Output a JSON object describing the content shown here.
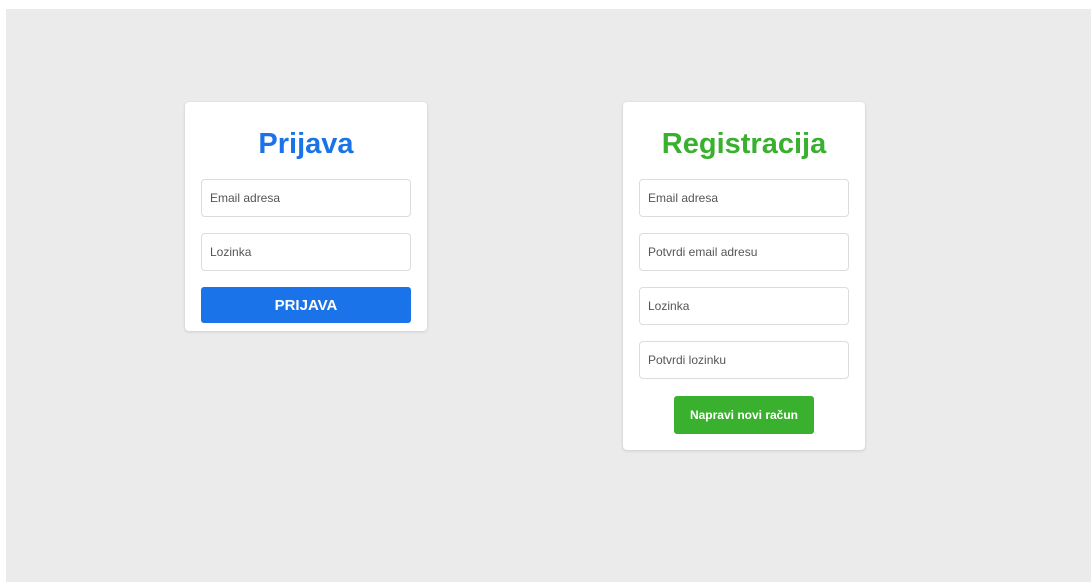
{
  "login": {
    "title": "Prijava",
    "email_placeholder": "Email adresa",
    "password_placeholder": "Lozinka",
    "submit_label": "PRIJAVA"
  },
  "register": {
    "title": "Registracija",
    "email_placeholder": "Email adresa",
    "confirm_email_placeholder": "Potvrdi email adresu",
    "password_placeholder": "Lozinka",
    "confirm_password_placeholder": "Potvrdi lozinku",
    "submit_label": "Napravi novi račun"
  },
  "colors": {
    "login_accent": "#1a73e8",
    "register_accent": "#3ab02f",
    "background": "#ebebeb"
  }
}
